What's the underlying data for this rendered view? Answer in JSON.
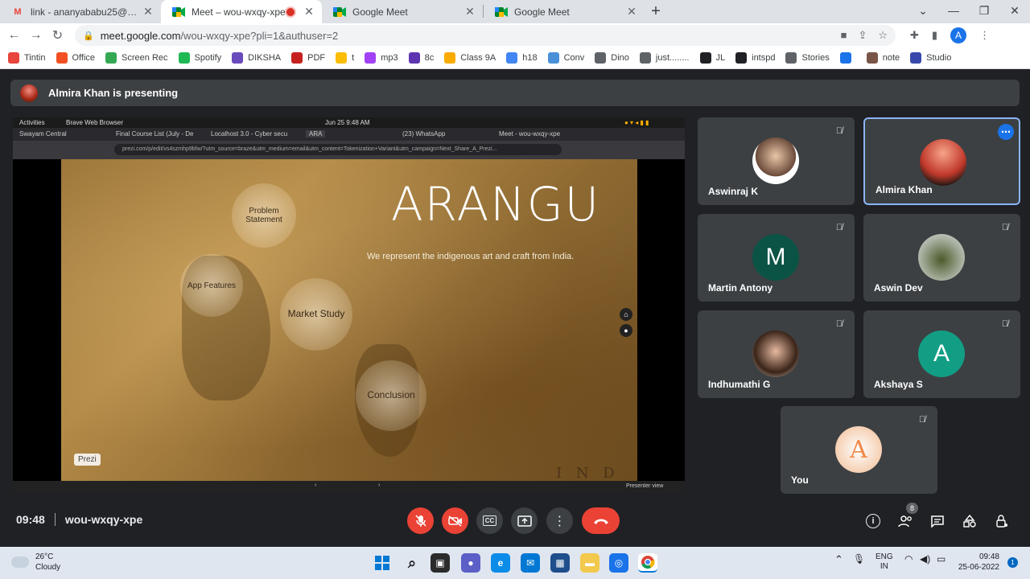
{
  "browser": {
    "tabs": [
      {
        "title": "link - ananyababu25@gmail.com",
        "favicon": "gmail-icon",
        "active": false
      },
      {
        "title": "Meet – wou-wxqy-xpe",
        "favicon": "meet-icon",
        "active": true,
        "recording": true
      },
      {
        "title": "Google Meet",
        "favicon": "meet-icon",
        "active": false
      },
      {
        "title": "Google Meet",
        "favicon": "meet-icon",
        "active": false
      }
    ],
    "new_tab": "+",
    "url_host": "meet.google.com",
    "url_path": "/wou-wxqy-xpe?pli=1&authuser=2",
    "profile_initial": "A",
    "bookmarks": [
      {
        "label": "Tintin",
        "color": "#e8453c"
      },
      {
        "label": "Office",
        "color": "#f25022"
      },
      {
        "label": "Screen Rec",
        "color": "#34a853"
      },
      {
        "label": "Spotify",
        "color": "#1db954"
      },
      {
        "label": "DIKSHA",
        "color": "#6a4bbd"
      },
      {
        "label": "PDF",
        "color": "#c5221f"
      },
      {
        "label": "t",
        "color": "#fbbc04"
      },
      {
        "label": "mp3",
        "color": "#a142f4"
      },
      {
        "label": "8c",
        "color": "#5e35b1"
      },
      {
        "label": "Class 9A",
        "color": "#f9ab00"
      },
      {
        "label": "h18",
        "color": "#4285f4"
      },
      {
        "label": "Conv",
        "color": "#4a90d9"
      },
      {
        "label": "Dino",
        "color": "#5f6368"
      },
      {
        "label": "just........",
        "color": "#5f6368"
      },
      {
        "label": "JL",
        "color": "#202124"
      },
      {
        "label": "intspd",
        "color": "#202124"
      },
      {
        "label": "Stories",
        "color": "#5f6368"
      },
      {
        "label": "",
        "color": "#1a73e8"
      },
      {
        "label": "note",
        "color": "#795548"
      },
      {
        "label": "Studio",
        "color": "#3949ab"
      }
    ]
  },
  "meet": {
    "presenting_text": "Almira Khan is presenting",
    "time": "09:48",
    "meeting_code": "wou-wxqy-xpe",
    "participant_count": "8",
    "participants": [
      {
        "name": "Aswinraj K",
        "avatar": "photo",
        "muted": true
      },
      {
        "name": "Almira Khan",
        "avatar": "photo",
        "muted": false,
        "active": true
      },
      {
        "name": "Martin Antony",
        "avatar": "letter",
        "letter": "M",
        "color": "#0b5345",
        "muted": true
      },
      {
        "name": "Aswin Dev",
        "avatar": "photo",
        "muted": true
      },
      {
        "name": "Indhumathi G",
        "avatar": "photo",
        "muted": true
      },
      {
        "name": "Akshaya S",
        "avatar": "letter",
        "letter": "A",
        "color": "#129e85",
        "muted": true
      },
      {
        "name": "You",
        "avatar": "letter",
        "letter": "A",
        "color": "#f4b183",
        "muted": true
      }
    ]
  },
  "shared_screen": {
    "activities": "Activities",
    "browser_name": "Brave Web Browser",
    "datetime": "Jun 25  9:48 AM",
    "inner_tabs": [
      "Swayam Central",
      "Final Course List (July - De",
      "Localhost 3.0 - Cyber secu",
      "ARA",
      "(23) WhatsApp",
      "Meet - wou-wxqy-xpe"
    ],
    "inner_url": "prezi.com/p/edit/vs4szmhp9bfw/?utm_source=braze&utm_medium=email&utm_content=Tokenization+Variant&utm_campaign=Next_Share_A_Prezi...",
    "slide_title": "ARANGU",
    "slide_subtitle": "We represent the indigenous art and craft from India.",
    "bubbles": [
      "Problem Statement",
      "App Features",
      "Market Study",
      "Conclusion"
    ],
    "prezi_label": "Prezi",
    "map_text": "I N D I",
    "presenter_view": "Presenter view"
  },
  "taskbar": {
    "temperature": "26°C",
    "condition": "Cloudy",
    "lang_top": "ENG",
    "lang_bottom": "IN",
    "clock_time": "09:48",
    "clock_date": "25-06-2022",
    "notifications": "1"
  }
}
